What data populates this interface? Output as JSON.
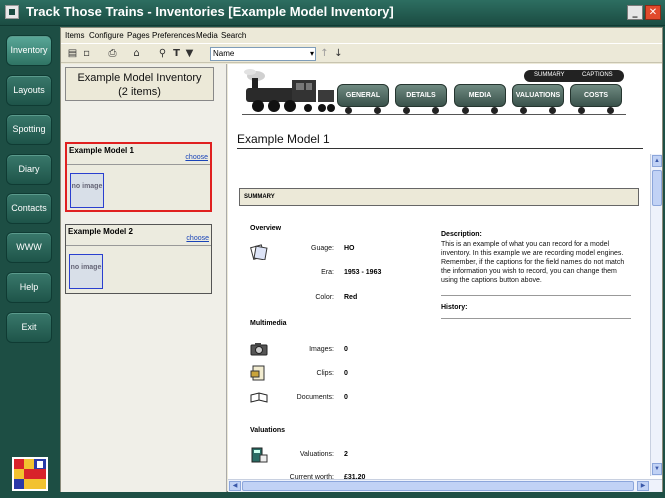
{
  "window": {
    "title": "Track Those Trains - Inventories [Example Model Inventory]",
    "minimize_glyph": "_",
    "close_glyph": "✕"
  },
  "nav": {
    "items": [
      {
        "label": "Inventory",
        "active": true
      },
      {
        "label": "Layouts"
      },
      {
        "label": "Spotting"
      },
      {
        "label": "Diary"
      },
      {
        "label": "Contacts"
      },
      {
        "label": "WWW"
      },
      {
        "label": "Help"
      },
      {
        "label": "Exit"
      }
    ]
  },
  "menu": [
    "Items",
    "Configure",
    "Pages",
    "Preferences",
    "Media",
    "Search"
  ],
  "toolbar": {
    "sort_field": "Name",
    "icons": [
      "book-icon",
      "save-icon",
      "print-icon",
      "home-icon",
      "search-icon",
      "text-icon",
      "filter-icon",
      "sort-asc-icon",
      "sort-desc-icon"
    ]
  },
  "list": {
    "title": "Example Model Inventory",
    "count": "(2 items)",
    "items": [
      {
        "name": "Example Model 1",
        "choose": "choose",
        "thumb": "no image",
        "selected": true
      },
      {
        "name": "Example Model 2",
        "choose": "choose",
        "thumb": "no image",
        "selected": false
      }
    ]
  },
  "detail": {
    "toggle": {
      "summary": "SUMMARY",
      "captions": "CAPTIONS"
    },
    "tabs": [
      "GENERAL",
      "DETAILS",
      "MEDIA",
      "VALUATIONS",
      "COSTS"
    ],
    "item_title": "Example Model 1",
    "summary_header": "SUMMARY",
    "overview": {
      "heading": "Overview",
      "guage_label": "Guage:",
      "guage_value": "HO",
      "era_label": "Era:",
      "era_value": "1953 - 1963",
      "color_label": "Color:",
      "color_value": "Red"
    },
    "multimedia": {
      "heading": "Multimedia",
      "images_label": "Images:",
      "images_value": "0",
      "clips_label": "Clips:",
      "clips_value": "0",
      "documents_label": "Documents:",
      "documents_value": "0"
    },
    "valuations": {
      "heading": "Valuations",
      "valuations_label": "Valuations:",
      "valuations_value": "2",
      "worth_label": "Current worth:",
      "worth_value": "£31.20"
    },
    "description_label": "Description:",
    "description_text": "This is an example of what you can record for a model inventory. In this example we are recording model engines. Remember, if the captions for the field names do not match the information you wish to record, you can change them using the captions button above.",
    "history_label": "History:"
  },
  "colors": {
    "window_bg": "#1e4f45",
    "selected_border": "#e02020",
    "link": "#1a44b8"
  }
}
